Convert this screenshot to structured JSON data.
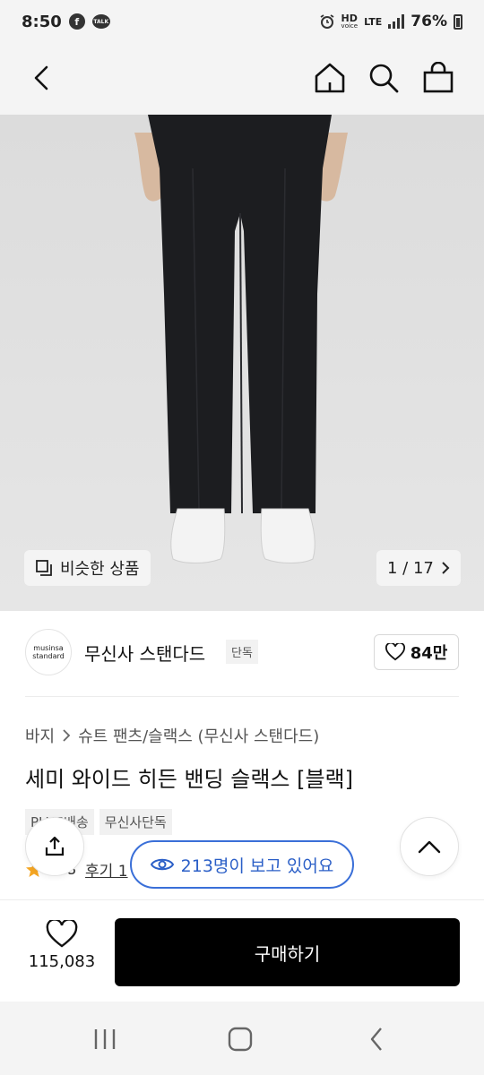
{
  "status_bar": {
    "time": "8:50",
    "notif_icons": [
      "facebook-icon",
      "kakaotalk-icon"
    ],
    "talk_label": "TALK",
    "facebook_glyph": "f",
    "hd_label": "HD",
    "voice_label": "voice",
    "lte_label": "LTE",
    "battery": "76%"
  },
  "header": {
    "icons": [
      "back-icon",
      "home-icon",
      "search-icon",
      "shopping-bag-icon"
    ]
  },
  "hero": {
    "similar_products_label": "비슷한 상품",
    "image_counter": "1 / 17"
  },
  "brand": {
    "logo_line1": "musinsa",
    "logo_line2": "standard",
    "name": "무신사 스탠다드",
    "exclusive_tag": "단독",
    "like_count": "84만"
  },
  "breadcrumb": {
    "category": "바지",
    "subcategory": "슈트 팬츠/슬랙스 (무신사 스탠다드)"
  },
  "product": {
    "title": "세미 와이드 히든 밴딩 슬랙스 [블랙]",
    "tags": [
      "PLUS배송",
      "무신사단독"
    ],
    "rating": "4.8",
    "review_label": "후기 1"
  },
  "overlay": {
    "viewers_text": "213명이 보고 있어요"
  },
  "action_bar": {
    "wish_count": "115,083",
    "buy_label": "구매하기"
  },
  "colors": {
    "primary": "#000000",
    "accent_blue": "#3a6fd8",
    "star": "#f5a623",
    "hero_bg": "#e1e1e1"
  }
}
